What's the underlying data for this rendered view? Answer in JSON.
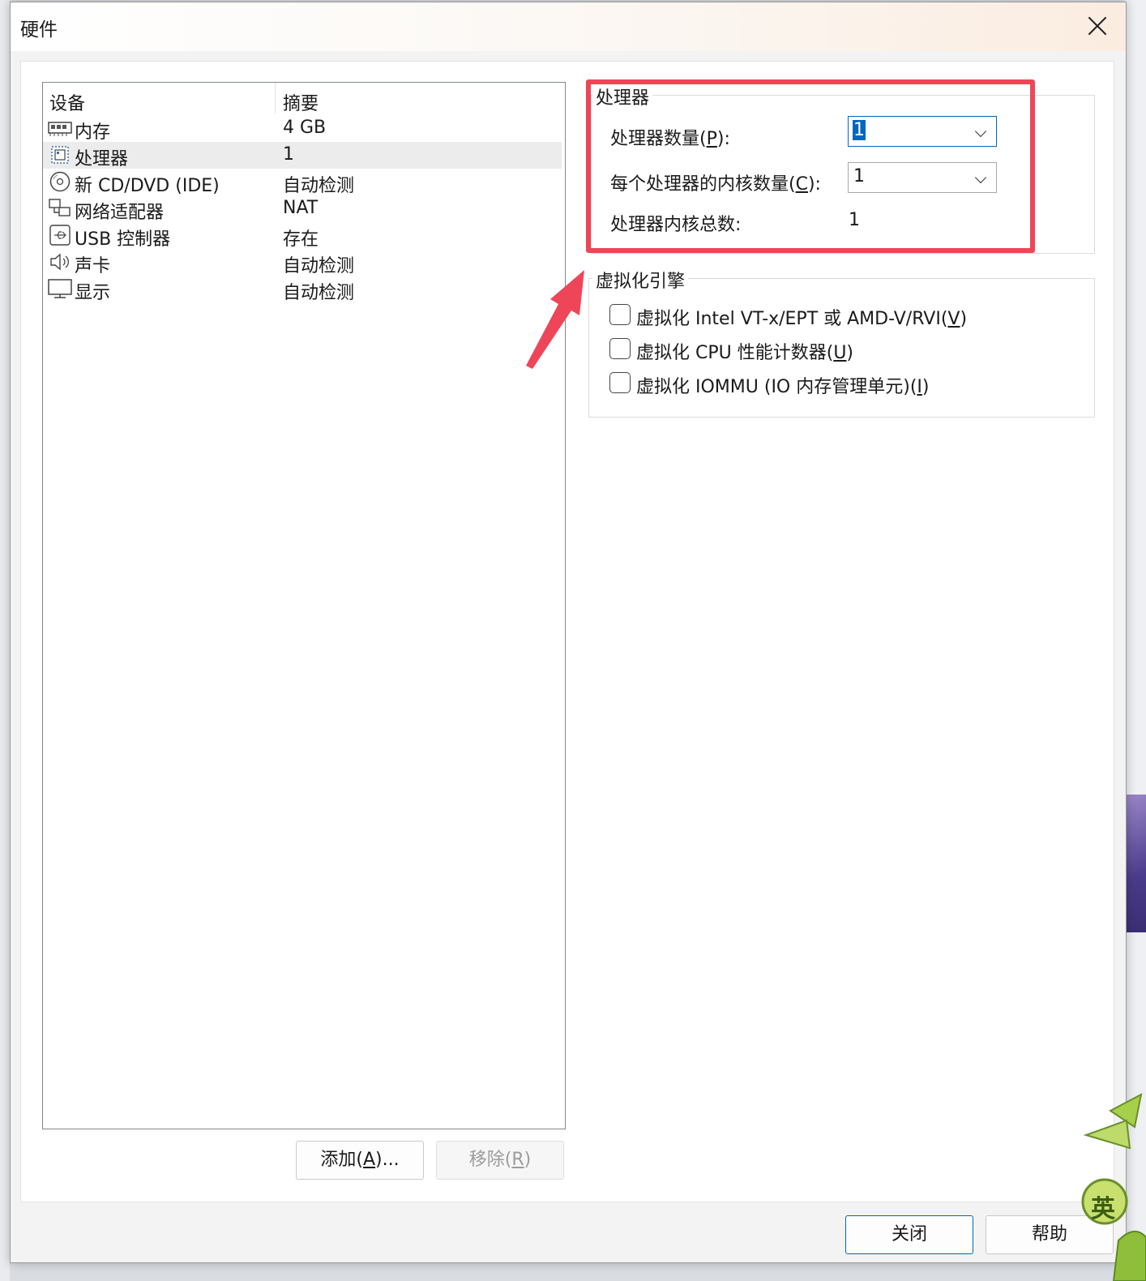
{
  "dialog": {
    "title": "硬件"
  },
  "device_list": {
    "columns": [
      "设备",
      "摘要"
    ],
    "rows": [
      {
        "icon": "memory-icon",
        "name": "内存",
        "summary": "4 GB"
      },
      {
        "icon": "processor-icon",
        "name": "处理器",
        "summary": "1",
        "selected": true
      },
      {
        "icon": "cd-dvd-icon",
        "name": "新 CD/DVD (IDE)",
        "summary": "自动检测"
      },
      {
        "icon": "network-adapter-icon",
        "name": "网络适配器",
        "summary": "NAT"
      },
      {
        "icon": "usb-icon",
        "name": "USB 控制器",
        "summary": "存在"
      },
      {
        "icon": "sound-icon",
        "name": "声卡",
        "summary": "自动检测"
      },
      {
        "icon": "display-icon",
        "name": "显示",
        "summary": "自动检测"
      }
    ]
  },
  "list_buttons": {
    "add": {
      "text": "添加(",
      "key": "A",
      "suffix": ")..."
    },
    "remove": {
      "text": "移除(",
      "key": "R",
      "suffix": ")"
    }
  },
  "processors": {
    "title": "处理器",
    "count_label": {
      "text": "处理器数量(",
      "key": "P",
      "suffix": "):"
    },
    "count_value": "1",
    "cores_label": {
      "text": "每个处理器的内核数量(",
      "key": "C",
      "suffix": "):"
    },
    "cores_value": "1",
    "total_label": "处理器内核总数:",
    "total_value": "1"
  },
  "virtualization": {
    "title": "虚拟化引擎",
    "options": [
      {
        "text": "虚拟化 Intel VT-x/EPT 或 AMD-V/RVI(",
        "key": "V",
        "suffix": ")",
        "checked": false
      },
      {
        "text": "虚拟化 CPU 性能计数器(",
        "key": "U",
        "suffix": ")",
        "checked": false
      },
      {
        "text": "虚拟化 IOMMU (IO 内存管理单元)(",
        "key": "I",
        "suffix": ")",
        "checked": false
      }
    ]
  },
  "footer": {
    "close_label": "关闭",
    "help_label": "帮助"
  },
  "overlay": {
    "mascot_char": "英",
    "highlight_color": "#ee4658"
  }
}
